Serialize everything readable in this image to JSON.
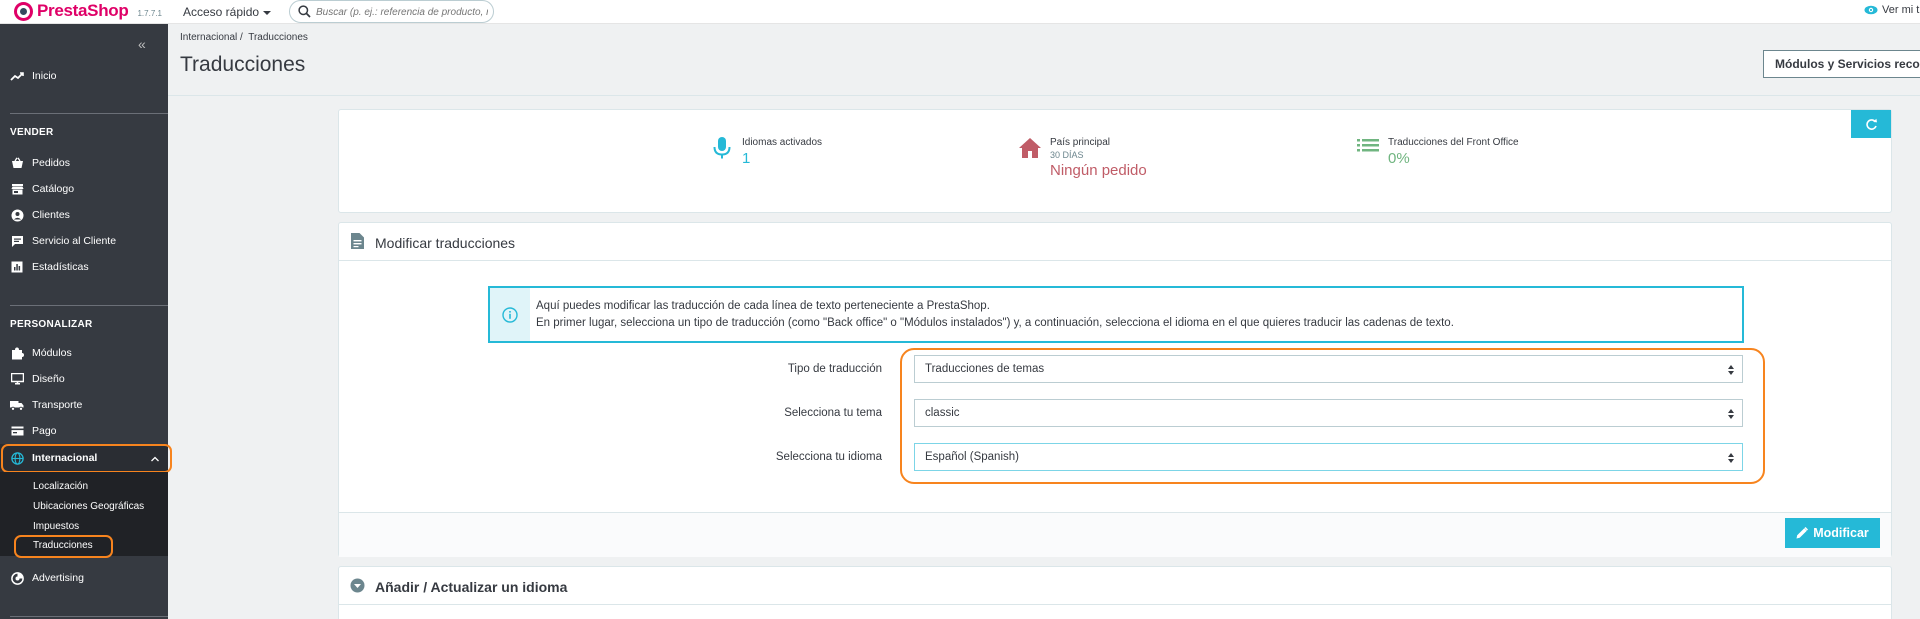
{
  "topbar": {
    "logo_text": "PrestaShop",
    "version": "1.7.7.1",
    "quick_access_label": "Acceso rápido",
    "search_placeholder": "Buscar (p. ej.: referencia de producto, no",
    "view_shop_label": "Ver mi t"
  },
  "sidebar": {
    "collapse_icon": "double-chevron-left-icon",
    "home_label": "Inicio",
    "sections": [
      {
        "title": "VENDER",
        "items": [
          {
            "label": "Pedidos",
            "icon": "shopping-basket-icon"
          },
          {
            "label": "Catálogo",
            "icon": "store-icon"
          },
          {
            "label": "Clientes",
            "icon": "account-circle-icon"
          },
          {
            "label": "Servicio al Cliente",
            "icon": "chat-icon"
          },
          {
            "label": "Estadísticas",
            "icon": "chart-icon"
          }
        ]
      },
      {
        "title": "PERSONALIZAR",
        "items": [
          {
            "label": "Módulos",
            "icon": "puzzle-icon"
          },
          {
            "label": "Diseño",
            "icon": "desktop-icon"
          },
          {
            "label": "Transporte",
            "icon": "truck-icon"
          },
          {
            "label": "Pago",
            "icon": "credit-card-icon"
          },
          {
            "label": "Internacional",
            "icon": "globe-icon"
          }
        ]
      }
    ],
    "submenu": [
      "Localización",
      "Ubicaciones Geográficas",
      "Impuestos",
      "Traducciones"
    ],
    "advertising_label": "Advertising"
  },
  "header": {
    "breadcrumb_1": "Internacional",
    "breadcrumb_sep": "/",
    "breadcrumb_2": "Traducciones",
    "title": "Traducciones",
    "recommended_button": "Módulos y Servicios recom"
  },
  "kpis": [
    {
      "label": "Idiomas activados",
      "sub": "",
      "value": "1",
      "color": "#25b9d7",
      "icon": "microphone-icon"
    },
    {
      "label": "País principal",
      "sub": "30 DÍAS",
      "value": "Ningún pedido",
      "color": "#c05c67",
      "icon": "home-icon"
    },
    {
      "label": "Traducciones del Front Office",
      "sub": "",
      "value": "0%",
      "color": "#70b580",
      "icon": "list-icon"
    }
  ],
  "panel": {
    "title": "Modificar traducciones",
    "info_line_1": "Aquí puedes modificar las traducción de cada línea de texto perteneciente a PrestaShop.",
    "info_line_2": "En primer lugar, selecciona un tipo de traducción (como \"Back office\" o \"Módulos instalados\") y, a continuación, selecciona el idioma en el que quieres traducir las cadenas de texto.",
    "fields": [
      {
        "label": "Tipo de traducción",
        "value": "Traducciones de temas"
      },
      {
        "label": "Selecciona tu tema",
        "value": "classic"
      },
      {
        "label": "Selecciona tu idioma",
        "value": "Español (Spanish)"
      }
    ],
    "submit_label": "Modificar"
  },
  "panel2": {
    "title": "Añadir / Actualizar un idioma"
  },
  "colors": {
    "accent": "#25b9d7",
    "highlight": "#f7841e",
    "sidebar_bg": "#363a41",
    "brand": "#df0067"
  }
}
